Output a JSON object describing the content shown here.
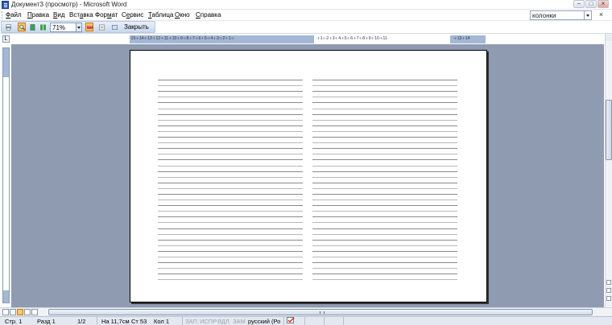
{
  "window": {
    "title": "Документ3 (просмотр) - Microsoft Word",
    "controls": {
      "minimize": "–",
      "maximize": "□",
      "close": "×"
    }
  },
  "menu": {
    "items": [
      {
        "pre": "",
        "u": "Ф",
        "post": "айл"
      },
      {
        "pre": "",
        "u": "П",
        "post": "равка"
      },
      {
        "pre": "",
        "u": "В",
        "post": "ид"
      },
      {
        "pre": "Вст",
        "u": "а",
        "post": "вка"
      },
      {
        "pre": "Фор",
        "u": "м",
        "post": "ат"
      },
      {
        "pre": "С",
        "u": "е",
        "post": "рвис"
      },
      {
        "pre": "",
        "u": "Т",
        "post": "аблица"
      },
      {
        "pre": "",
        "u": "О",
        "post": "кно"
      },
      {
        "pre": "",
        "u": "С",
        "post": "правка"
      }
    ],
    "help_box_value": "колонки",
    "doc_close": "×"
  },
  "toolbar": {
    "zoom_value": "71%",
    "close_label": "Закрыть",
    "buttons": [
      "print-icon",
      "magnifier-icon",
      "one-page-icon",
      "multiple-pages-icon",
      "view-ruler-icon",
      "shrink-to-fit-icon",
      "full-screen-icon"
    ]
  },
  "ruler": {
    "left_numbers": "·15·ı·14·ı·13·ı·12·ı·11·ı·10·ı·9·ı·8·ı·7·ı·6·ı·5·ı·4·ı·3·ı·2·ı·1·ı·",
    "right_numbers": "·ı·1·ı·2·ı·3·ı·4·ı·5·ı·6·ı·7·ı·8·ı·9·ı·10·ı·11·",
    "right_margin_numbers": "·ı·13·ı·14"
  },
  "statusbar": {
    "page": "Стр. 1",
    "section": "Разд 1",
    "page_of": "1/2",
    "position": "На 11,7см",
    "line": "Ст 53",
    "column": "Кол 1",
    "rec": "ЗАП",
    "track": "ИСПР",
    "extend": "ВДЛ",
    "overtype": "ЗАМ",
    "language": "русский (Ро"
  },
  "document": {
    "columns": 2,
    "lines_per_column": 36
  },
  "colors": {
    "workspace": "#8f9bb0",
    "ruler_margin": "#a4b7d6",
    "toolbar_active": "#f7c66e"
  }
}
